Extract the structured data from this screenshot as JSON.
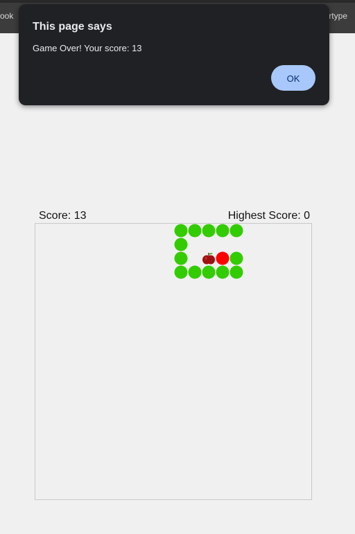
{
  "browser": {
    "bookmark_left": "ook",
    "bookmark_right": "rtype"
  },
  "dialog": {
    "title": "This page says",
    "message": "Game Over! Your score: 13",
    "ok_label": "OK"
  },
  "hud": {
    "score_text": "Score: 13",
    "highest_text": "Highest Score: 0"
  },
  "game": {
    "grid_columns": 20,
    "grid_rows": 20,
    "snake_color": "#33cc00",
    "head_color": "#ff0000",
    "apple_color": "#a01010",
    "snake_head": [
      13,
      2
    ],
    "snake_body": [
      [
        14,
        2
      ],
      [
        14,
        3
      ],
      [
        13,
        3
      ],
      [
        12,
        3
      ],
      [
        11,
        3
      ],
      [
        10,
        3
      ],
      [
        10,
        2
      ],
      [
        10,
        1
      ],
      [
        10,
        0
      ],
      [
        11,
        0
      ],
      [
        12,
        0
      ],
      [
        13,
        0
      ],
      [
        14,
        0
      ]
    ],
    "apple": [
      12,
      2
    ]
  }
}
